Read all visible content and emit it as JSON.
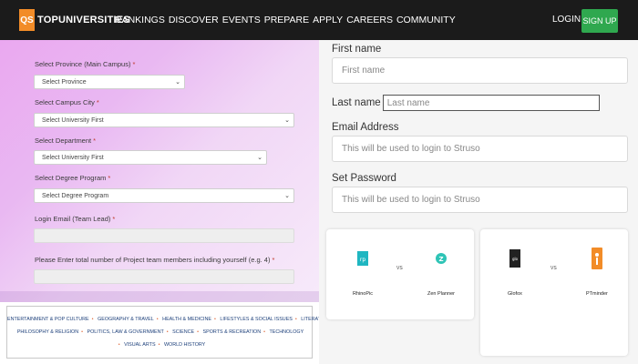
{
  "header": {
    "logo_mark": "QS",
    "logo_text": "TOPUNIVERSITIES",
    "nav_items": [
      "RANKINGS",
      "DISCOVER",
      "EVENTS",
      "PREPARE",
      "APPLY",
      "CAREERS",
      "COMMUNITY"
    ],
    "login": "LOGIN",
    "signup": "SIGN UP"
  },
  "form": {
    "province": {
      "label": "Select Province (Main Campus)",
      "value": "Select Province"
    },
    "city": {
      "label": "Select Campus City",
      "value": "Select University First"
    },
    "department": {
      "label": "Select Department",
      "value": "Select University First"
    },
    "degree": {
      "label": "Select Degree Program",
      "value": "Select Degree Program"
    },
    "login_email": {
      "label": "Login Email (Team Lead)",
      "value": ""
    },
    "members": {
      "label": "Please Enter total number of Project team members including yourself (e.g. 4)",
      "value": ""
    },
    "required_mark": "*"
  },
  "tags": {
    "line1": [
      "ENTERTAINMENT & POP CULTURE",
      "GEOGRAPHY & TRAVEL",
      "HEALTH & MEDICINE",
      "LIFESTYLES & SOCIAL ISSUES",
      "LITERATURE"
    ],
    "line2": [
      "PHILOSOPHY & RELIGION",
      "POLITICS, LAW & GOVERNMENT",
      "SCIENCE",
      "SPORTS & RECREATION",
      "TECHNOLOGY"
    ],
    "line3": [
      "VISUAL ARTS",
      "WORLD HISTORY"
    ],
    "separator": "•"
  },
  "signup_form": {
    "first_name": {
      "label": "First name",
      "placeholder": "First name"
    },
    "last_name": {
      "label": "Last name",
      "placeholder": "Last name"
    },
    "email": {
      "label": "Email Address",
      "placeholder": "This will be used to login to Struso"
    },
    "password": {
      "label": "Set Password",
      "placeholder": "This will be used to login to Struso"
    }
  },
  "comparisons": [
    {
      "a": "RhinoPic",
      "b": "Zen Planner",
      "vs": "VS"
    },
    {
      "a": "Glofox",
      "b": "PTminder",
      "vs": "VS"
    }
  ],
  "colors": {
    "header_bg": "#1b1b1b",
    "logo_orange": "#f28c28",
    "signup_green": "#2fa84f",
    "tag_blue": "#1c3f7a",
    "rhinopic_teal": "#1fb6c1",
    "zenplanner_teal": "#2ec4b6",
    "glofox_dark": "#222222",
    "ptminder_orange": "#f28c28"
  }
}
